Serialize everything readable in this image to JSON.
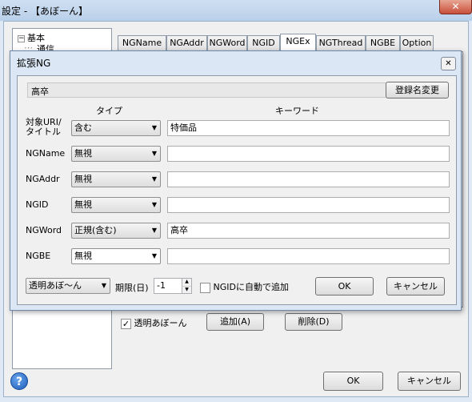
{
  "window": {
    "title": "設定 - 【あぼーん】",
    "close_glyph": "✕"
  },
  "tree": {
    "root_label": "基本",
    "root_toggle": "⊟",
    "child_label": "通信"
  },
  "tabs": [
    "NGName",
    "NGAddr",
    "NGWord",
    "NGID",
    "NGEx",
    "NGThread",
    "NGBE",
    "Option"
  ],
  "active_tab": "NGEx",
  "main": {
    "transparent_label": "透明あぼーん",
    "transparent_checked": true,
    "add_button": "追加(A)",
    "delete_button": "削除(D)",
    "ok_button": "OK",
    "cancel_button": "キャンセル",
    "help_icon": "?"
  },
  "dialog": {
    "title": "拡張NG",
    "close_glyph": "✕",
    "name_value": "高卒",
    "rename_button": "登録名変更",
    "col_type": "タイプ",
    "col_keyword": "キーワード",
    "rows": [
      {
        "label": "対象URI/\nタイトル",
        "type": "含む",
        "keyword": "特価品"
      },
      {
        "label": "NGName",
        "type": "無視",
        "keyword": ""
      },
      {
        "label": "NGAddr",
        "type": "無視",
        "keyword": ""
      },
      {
        "label": "NGID",
        "type": "無視",
        "keyword": ""
      },
      {
        "label": "NGWord",
        "type": "正規(含む)",
        "keyword": "高卒"
      },
      {
        "label": "NGBE",
        "type": "無視",
        "keyword": ""
      }
    ],
    "abone_mode": "透明あぼ〜ん",
    "limit_label": "期限(日)",
    "limit_value": "-1",
    "ngid_auto_label": "NGIDに自動で追加",
    "ngid_auto_checked": false,
    "ok_button": "OK",
    "cancel_button": "キャンセル"
  },
  "colors": {
    "frame": "#dfe9f5",
    "dialog": "#dbe7f4",
    "client": "#f0f0f0",
    "help": "#1f5ab8"
  }
}
